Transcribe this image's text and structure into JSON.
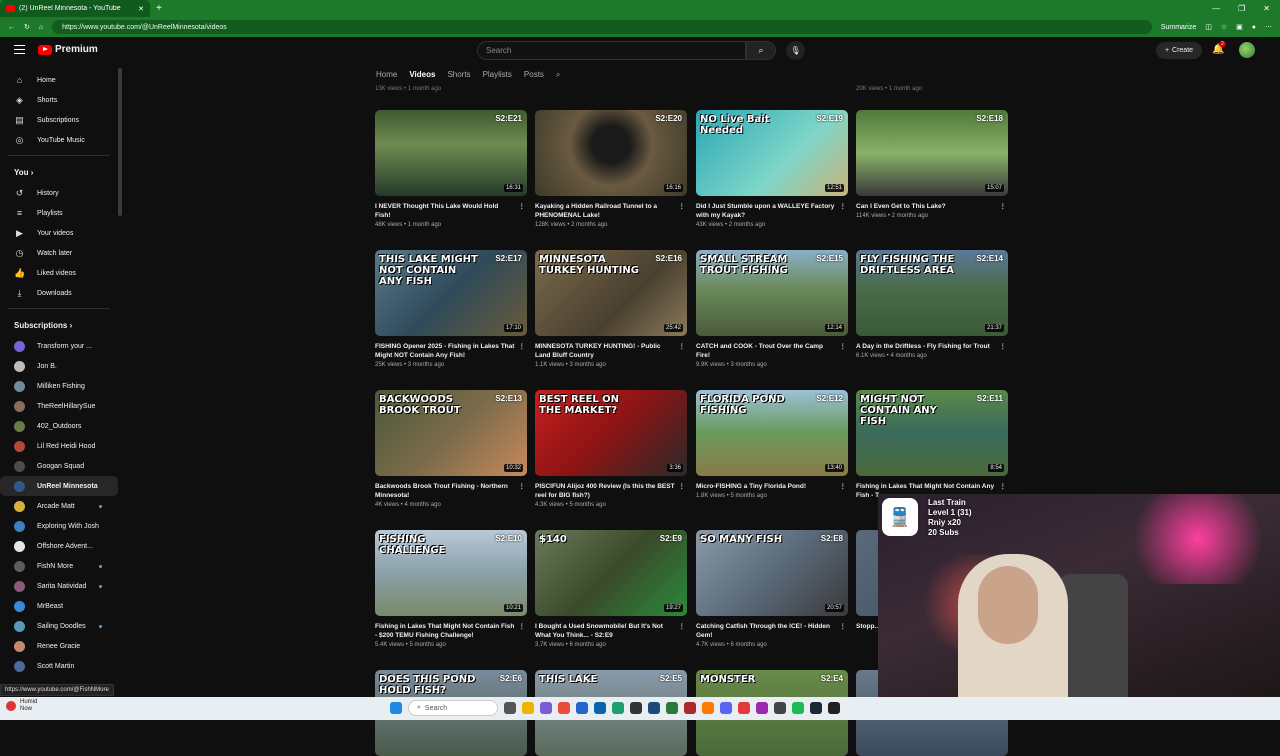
{
  "browser": {
    "tab_title": "(2) UnReel Minnesota - YouTube",
    "url": "https://www.youtube.com/@UnReelMinnesota/videos",
    "summarize": "Summarize"
  },
  "masthead": {
    "logo_text": "Premium",
    "search_placeholder": "Search",
    "create_label": "Create",
    "notif_count": "2"
  },
  "sidebar": {
    "main": [
      {
        "label": "Home",
        "icon": "home-icon",
        "glyph": "⌂"
      },
      {
        "label": "Shorts",
        "icon": "shorts-icon",
        "glyph": "◈"
      },
      {
        "label": "Subscriptions",
        "icon": "subscriptions-icon",
        "glyph": "▤"
      },
      {
        "label": "YouTube Music",
        "icon": "music-icon",
        "glyph": "◎"
      }
    ],
    "you_heading": "You",
    "you": [
      {
        "label": "History",
        "glyph": "↺"
      },
      {
        "label": "Playlists",
        "glyph": "≡"
      },
      {
        "label": "Your videos",
        "glyph": "▶"
      },
      {
        "label": "Watch later",
        "glyph": "◷"
      },
      {
        "label": "Liked videos",
        "glyph": "👍"
      },
      {
        "label": "Downloads",
        "glyph": "⤓"
      }
    ],
    "subs_heading": "Subscriptions",
    "subs": [
      {
        "label": "Transform your ...",
        "color": "#7a63d8",
        "dot": false,
        "live": true
      },
      {
        "label": "Jon B.",
        "color": "#bdbdbd",
        "dot": false
      },
      {
        "label": "Milliken Fishing",
        "color": "#6e8a9c",
        "dot": false
      },
      {
        "label": "TheReelHillarySue",
        "color": "#8c6b5a",
        "dot": false
      },
      {
        "label": "402_Outdoors",
        "color": "#6a7a4a",
        "dot": false
      },
      {
        "label": "Lil Red Heidi Hood",
        "color": "#b5483c",
        "dot": false
      },
      {
        "label": "Googan Squad",
        "color": "#4d4d4d",
        "dot": false
      },
      {
        "label": "UnReel Minnesota",
        "color": "#2e5a8a",
        "dot": false,
        "active": true
      },
      {
        "label": "Arcade Matt",
        "color": "#d8b23c",
        "dot": true
      },
      {
        "label": "Exploring With Josh",
        "color": "#3d7fbf",
        "dot": false
      },
      {
        "label": "Offshore Advent...",
        "color": "#e6e6e6",
        "dot": true
      },
      {
        "label": "FishN More",
        "color": "#5d5d5d",
        "dot": true
      },
      {
        "label": "Sarita Natividad",
        "color": "#8a5a7a",
        "dot": true
      },
      {
        "label": "MrBeast",
        "color": "#3b89d9",
        "dot": false
      },
      {
        "label": "Sailing Doodles",
        "color": "#5a98b8",
        "dot": true
      },
      {
        "label": "Renee Gracie",
        "color": "#c48a6a",
        "dot": false
      },
      {
        "label": "Scott Martin",
        "color": "#4a6a9a",
        "dot": false
      }
    ]
  },
  "channel_tabs": [
    "Home",
    "Videos",
    "Shorts",
    "Playlists",
    "Posts"
  ],
  "prev_row_meta": [
    "13K views • 1 month ago",
    "",
    "",
    "20K views • 1 month ago"
  ],
  "videos": [
    {
      "ep": "S2:E21",
      "big": "",
      "dur": "16:31",
      "title": "I NEVER Thought This Lake Would Hold Fish!",
      "meta": "48K views • 1 month ago",
      "bg": "linear-gradient(180deg,#3f5a2f,#6f8c52 40%,#253a2a)"
    },
    {
      "ep": "S2:E20",
      "big": "",
      "dur": "16:16",
      "title": "Kayaking a Hidden Railroad Tunnel to a PHENOMENAL Lake!",
      "meta": "128K views • 2 months ago",
      "bg": "radial-gradient(circle at 50% 40%,#1a1a1a 20%,#6a5a40 45%,#3d3a2a)"
    },
    {
      "ep": "S2:E19",
      "big": "NO Live Bait Needed",
      "dur": "12:51",
      "title": "Did I Just Stumble upon a WALLEYE Factory with my Kayak?",
      "meta": "43K views • 2 months ago",
      "bg": "linear-gradient(135deg,#2aa7b5,#7fd6c8 60%,#c9b37a)"
    },
    {
      "ep": "S2:E18",
      "big": "",
      "dur": "15:07",
      "title": "Can I Even Get to This Lake?",
      "meta": "114K views • 2 months ago",
      "bg": "linear-gradient(180deg,#4f7a3a,#8ab06a 50%,#3a3a3a)"
    },
    {
      "ep": "S2:E17",
      "big": "THIS LAKE MIGHT NOT CONTAIN ANY FISH",
      "dur": "17:10",
      "title": "FISHING Opener 2025 - Fishing in Lakes That Might NOT Contain Any Fish!",
      "meta": "25K views • 3 months ago",
      "bg": "linear-gradient(135deg,#5a7a8a,#2f4a5a 50%,#6a5a3a)"
    },
    {
      "ep": "S2:E16",
      "big": "MINNESOTA TURKEY HUNTING",
      "dur": "25:42",
      "title": "MINNESOTA TURKEY HUNTING! - Public Land Bluff Country",
      "meta": "1.1K views • 3 months ago",
      "bg": "linear-gradient(135deg,#7a6a4a,#4a4030 60%,#8a7a5a)"
    },
    {
      "ep": "S2:E15",
      "big": "SMALL STREAM TROUT FISHING",
      "dur": "12:14",
      "title": "CATCH and COOK - Trout Over the Camp Fire!",
      "meta": "9.9K views • 3 months ago",
      "bg": "linear-gradient(180deg,#8ab0c8,#6a8a5a 45%,#4a5a3a)"
    },
    {
      "ep": "S2:E14",
      "big": "FLY FISHING THE DRIFTLESS AREA",
      "dur": "21:37",
      "title": "A Day in the Driftless - Fly Fishing for Trout",
      "meta": "6.1K views • 4 months ago",
      "bg": "linear-gradient(180deg,#5a7a9a,#4a6a4a 45%,#3a5a3a)"
    },
    {
      "ep": "S2:E13",
      "big": "BACKWOODS BROOK TROUT",
      "dur": "10:32",
      "title": "Backwoods Brook Trout Fishing - Northern Minnesota!",
      "meta": "4K views • 4 months ago",
      "bg": "linear-gradient(135deg,#4a5a3a,#7a6a4a 50%,#c88a5a)"
    },
    {
      "ep": "",
      "big": "BEST REEL ON THE MARKET?",
      "dur": "3:36",
      "title": "PISCIFUN Alijoz 400 Review (Is this the BEST reel for BIG fish?)",
      "meta": "4.3K views • 5 months ago",
      "bg": "linear-gradient(135deg,#c81e1e,#8a1414 50%,#2a2a2a)"
    },
    {
      "ep": "S2:E12",
      "big": "FLORIDA POND FISHING",
      "dur": "13:40",
      "title": "Micro-FISHING a Tiny Florida Pond!",
      "meta": "1.8K views • 5 months ago",
      "bg": "linear-gradient(180deg,#9ac0d8,#6a9a5a 50%,#8a7a4a)"
    },
    {
      "ep": "S2:E11",
      "big": "MIGHT NOT CONTAIN ANY FISH",
      "dur": "8:54",
      "title": "Fishing in Lakes That Might Not Contain Any Fish - T...",
      "meta": "",
      "bg": "linear-gradient(180deg,#5a8a4a,#3a6a5a 50%,#4a6a3a)"
    },
    {
      "ep": "S2:E10",
      "big": "FISHING CHALLENGE",
      "dur": "10:21",
      "title": "Fishing in Lakes That Might Not Contain Fish - $200 TEMU Fishing Challenge!",
      "meta": "5.4K views • 5 months ago",
      "bg": "linear-gradient(180deg,#b8c8d8,#8aa0a8 50%,#7a8a6a)"
    },
    {
      "ep": "S2:E9",
      "big": "$140",
      "dur": "19:27",
      "title": "I Bought a Used Snowmobile! But It's Not What You Think... - S2:E9",
      "meta": "3.7K views • 6 months ago",
      "bg": "linear-gradient(135deg,#6a7a5a,#3a4a2a 50%,#2a8a3a)"
    },
    {
      "ep": "S2:E8",
      "big": "SO MANY FISH",
      "dur": "20:57",
      "title": "Catching Catfish Through the ICE! - Hidden Gem!",
      "meta": "4.7K views • 6 months ago",
      "bg": "linear-gradient(135deg,#8a9aa8,#5a6a7a 50%,#3a3a3a)"
    },
    {
      "ep": "",
      "big": "",
      "dur": "",
      "title": "Stopp... Tourna...",
      "meta": "",
      "bg": "linear-gradient(135deg,#5a6a7a,#3a4a5a)"
    },
    {
      "ep": "S2:E6",
      "big": "DOES THIS POND HOLD FISH?",
      "dur": "",
      "title": "",
      "meta": "",
      "bg": "linear-gradient(180deg,#7a8a9a,#4a5a4a)"
    },
    {
      "ep": "S2:E5",
      "big": "THIS LAKE",
      "dur": "",
      "title": "",
      "meta": "",
      "bg": "linear-gradient(180deg,#8a9aaa,#5a6a5a)"
    },
    {
      "ep": "S2:E4",
      "big": "MONSTER",
      "dur": "",
      "title": "",
      "meta": "",
      "bg": "linear-gradient(180deg,#6a8a4a,#4a6a3a)"
    },
    {
      "ep": "",
      "big": "",
      "dur": "",
      "title": "",
      "meta": "",
      "bg": "linear-gradient(180deg,#6a7a8a,#3a4a5a)"
    }
  ],
  "overlay": {
    "line1": "Last Train",
    "line2": "Level 1  (31)",
    "line3": "Rniy x20",
    "line4": "20 Subs"
  },
  "status_link": "https://www.youtube.com/@FishNMore",
  "taskbar": {
    "weather_line1": "Humid",
    "weather_line2": "Now",
    "search_label": "Search"
  }
}
